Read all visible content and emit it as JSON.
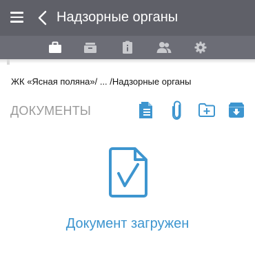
{
  "appbar": {
    "title": "Надзорные органы",
    "menu_icon": "hamburger-menu-icon",
    "back_icon": "chevron-left-icon"
  },
  "tabs": [
    {
      "icon": "briefcase-icon",
      "active": true
    },
    {
      "icon": "inbox-tray-icon",
      "active": false
    },
    {
      "icon": "info-clipboard-icon",
      "active": false
    },
    {
      "icon": "people-icon",
      "active": false
    },
    {
      "icon": "gear-icon",
      "active": false
    }
  ],
  "breadcrumb": "ЖК «Ясная поляна»/ ... /Надзорные органы",
  "section": {
    "title": "ДОКУМЕНТЫ",
    "actions": [
      "document-list-icon",
      "paperclip-icon",
      "add-folder-icon",
      "download-box-icon"
    ]
  },
  "upload_status": {
    "text": "Документ загружен",
    "icon": "document-check-icon"
  },
  "colors": {
    "appbar": "#5f6068",
    "tabbar": "#6c6d76",
    "accent": "#3d95cf",
    "muted_text": "#9a9a9a"
  }
}
